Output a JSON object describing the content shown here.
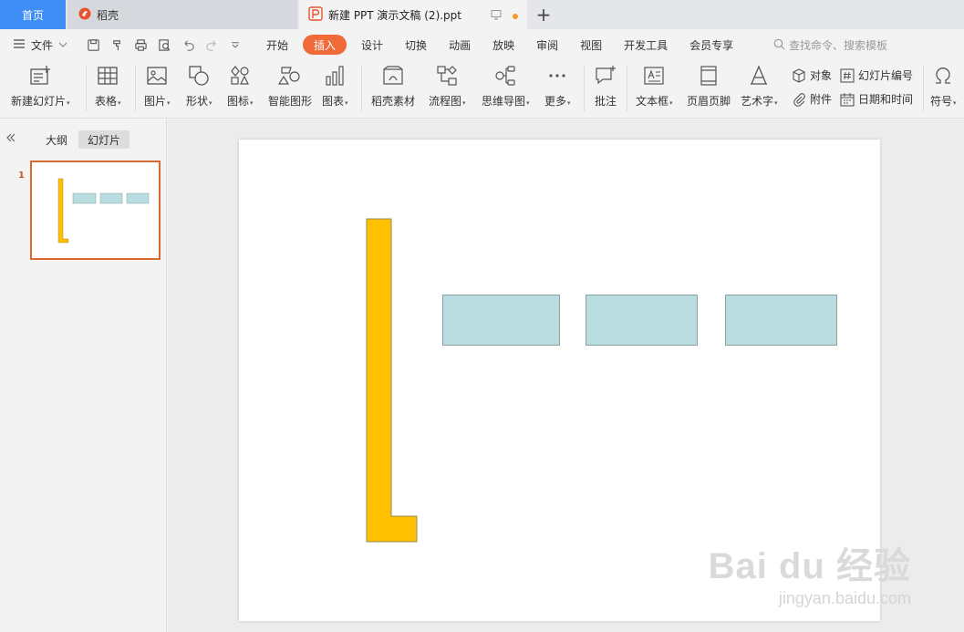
{
  "tabs": {
    "home": "首页",
    "daoke": "稻壳",
    "document": "新建 PPT 演示文稿 (2).ppt"
  },
  "menu": {
    "file": "文件",
    "items": [
      "开始",
      "插入",
      "设计",
      "切换",
      "动画",
      "放映",
      "审阅",
      "视图",
      "开发工具",
      "会员专享"
    ],
    "active_index": 1,
    "search_placeholder": "查找命令、搜索模板"
  },
  "ribbon": {
    "new_slide": "新建幻灯片",
    "table": "表格",
    "picture": "图片",
    "shape": "形状",
    "icon": "图标",
    "smart_art": "智能图形",
    "chart": "图表",
    "daoke_material": "稻壳素材",
    "flowchart": "流程图",
    "mindmap": "思维导图",
    "more": "更多",
    "comment": "批注",
    "textbox": "文本框",
    "header_footer": "页眉页脚",
    "wordart": "艺术字",
    "object": "对象",
    "attachment": "附件",
    "slide_number": "幻灯片编号",
    "date_time": "日期和时间",
    "symbol": "符号"
  },
  "panel": {
    "outline_tab": "大纲",
    "slides_tab": "幻灯片",
    "slide_number": "1"
  },
  "colors": {
    "accent_orange": "#ef6b3a",
    "home_tab_blue": "#3f8ef5",
    "l_shape_fill": "#ffc000",
    "rect_fill": "#b9dce0",
    "thumb_border": "#d9692e"
  },
  "watermark": {
    "logo": "Bai du 经验",
    "url": "jingyan.baidu.com"
  }
}
